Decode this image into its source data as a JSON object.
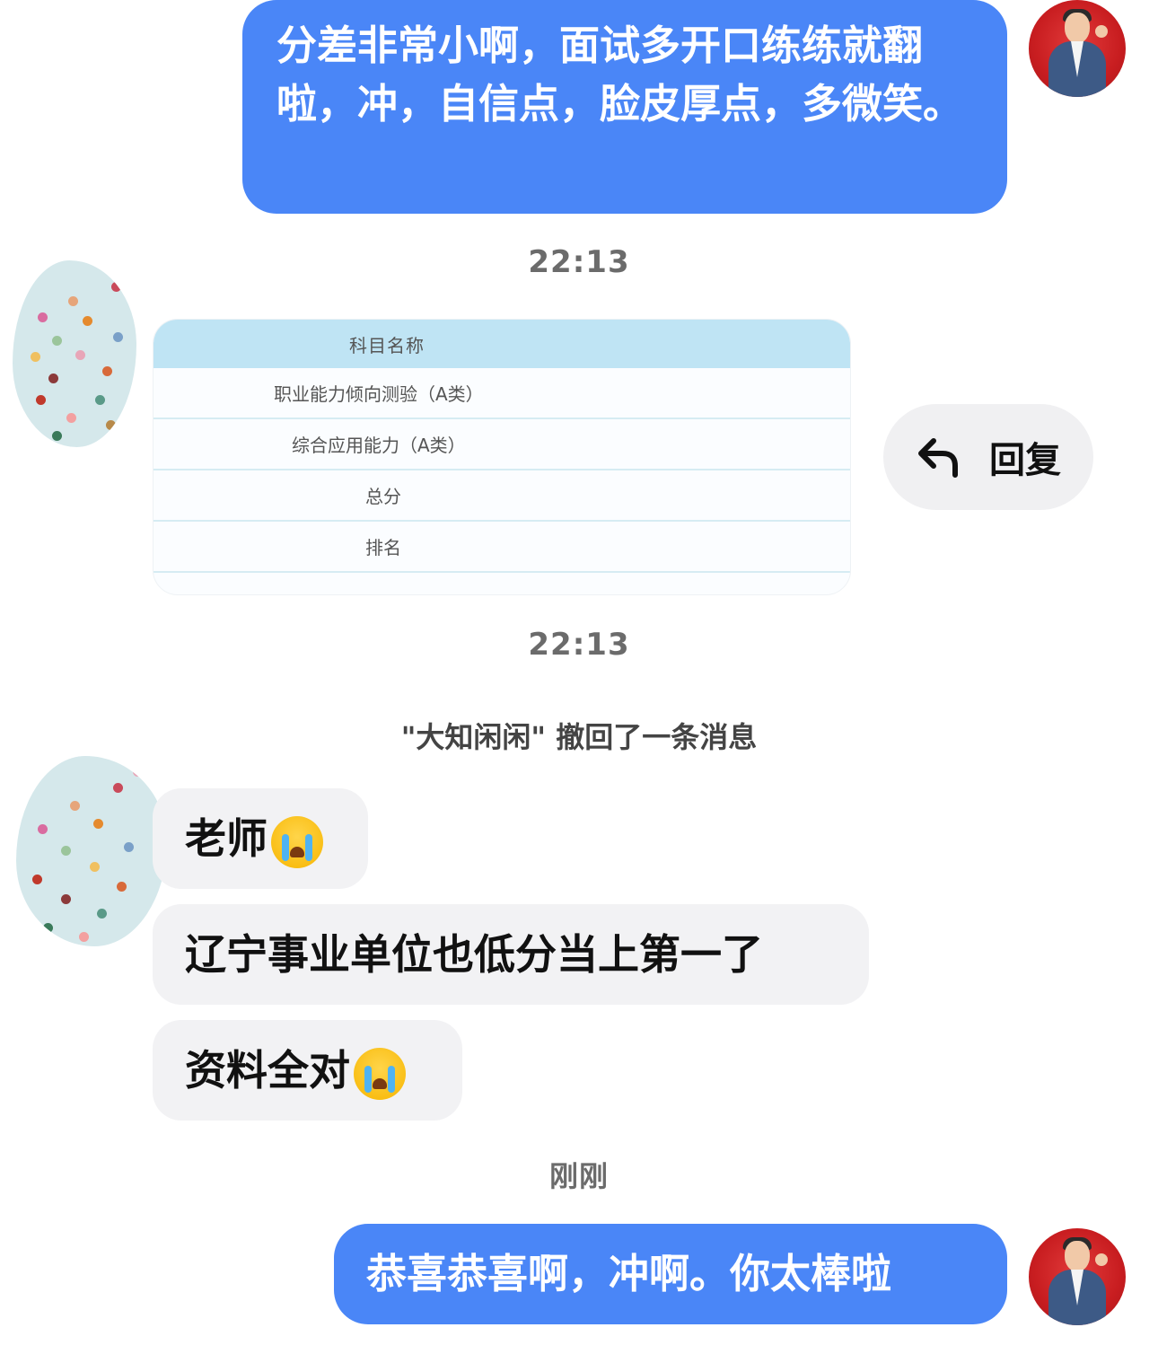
{
  "messages": {
    "msg1": "分差非常小啊，面试多开口练练就翻啦，冲，自信点，脸皮厚点，多微笑。",
    "time1": "22:13",
    "image_table": {
      "header": "科目名称",
      "rows": [
        "职业能力倾向测验（A类）",
        "综合应用能力（A类）",
        "总分",
        "排名"
      ]
    },
    "reply_label": "回复",
    "time2": "22:13",
    "system_notice": "\"大知闲闲\" 撤回了一条消息",
    "in1": "老师",
    "in2": "辽宁事业单位也低分当上第一了",
    "in3": "资料全对",
    "time3": "刚刚",
    "msg_last": "恭喜恭喜啊，冲啊。你太棒啦"
  },
  "colors": {
    "outgoing_bubble": "#4a86f7",
    "incoming_bubble": "#f2f2f4",
    "table_header": "#bfe4f4"
  },
  "icons": {
    "reply": "reply-arrow-icon",
    "emoji": "loudly-crying-face-emoji"
  }
}
